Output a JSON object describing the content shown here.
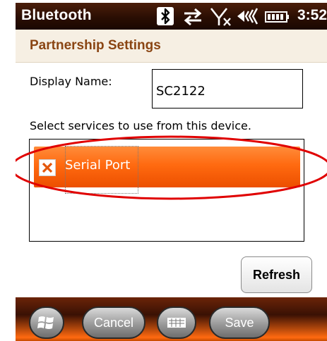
{
  "titlebar": {
    "app_title": "Bluetooth",
    "time": "3:52"
  },
  "status_icons": [
    "bluetooth-icon",
    "sync-arrows-icon",
    "no-signal-icon",
    "volume-icon",
    "battery-icon"
  ],
  "header": {
    "page_title": "Partnership Settings"
  },
  "form": {
    "display_name_label": "Display Name:",
    "display_name_value": "SC2122",
    "services_prompt": "Select services to use from this device."
  },
  "services": [
    {
      "label": "Serial Port",
      "checked": true
    }
  ],
  "buttons": {
    "refresh": "Refresh",
    "cancel": "Cancel",
    "save": "Save"
  },
  "colors": {
    "accent": "#ff6a10",
    "title_bar": "#2a0e03",
    "header_text": "#8a4513",
    "highlight_ring": "#e00000"
  }
}
